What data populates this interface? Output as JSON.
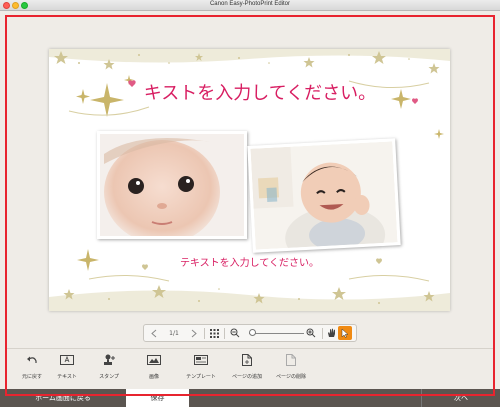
{
  "window": {
    "title": "Canon Easy-PhotoPrint Editor"
  },
  "card": {
    "title": "キストを入力してください。",
    "subtitle": "テキストを入力してください。"
  },
  "navigator": {
    "page": "1/1"
  },
  "toolbar": {
    "items": [
      {
        "label": "元に戻す",
        "icon": "undo-icon"
      },
      {
        "label": "テキスト",
        "icon": "text-box-icon"
      },
      {
        "label": "スタンプ",
        "icon": "stamp-icon"
      },
      {
        "label": "画像",
        "icon": "image-icon"
      },
      {
        "label": "テンプレート",
        "icon": "template-icon"
      },
      {
        "label": "ページの追加",
        "icon": "add-page-icon"
      },
      {
        "label": "ページの削除",
        "icon": "delete-page-icon"
      }
    ]
  },
  "bottom": {
    "home": "ホーム画面に戻る",
    "save": "保存",
    "next": "次へ"
  },
  "colors": {
    "highlight_frame": "#e8242f",
    "title_text": "#d81e62",
    "pointer_active": "#f08a12",
    "bottom_bar": "#5b5550"
  }
}
